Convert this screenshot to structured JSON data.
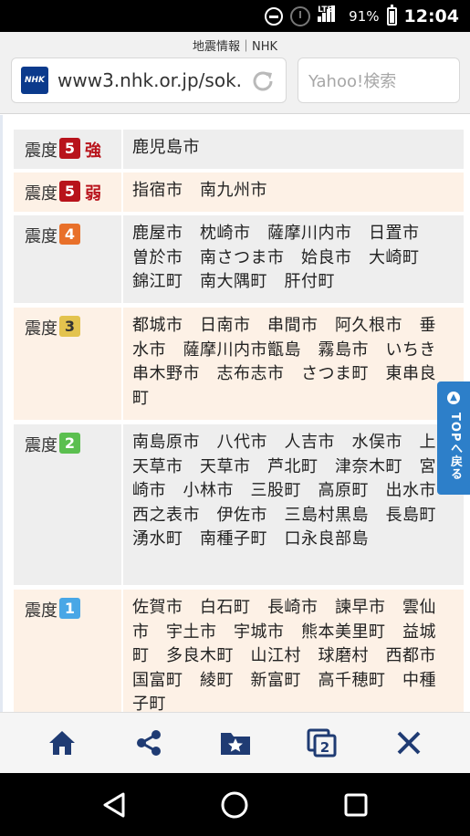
{
  "status": {
    "network": "LTE",
    "battery": "91%",
    "time": "12:04"
  },
  "browser": {
    "site_title": "地震情報｜NHK",
    "logo_text": "NHK",
    "url": "www3.nhk.or.jp/sok...",
    "search_placeholder": "Yahoo!検索"
  },
  "colors": {
    "badge_5": "#b8131b",
    "badge_4": "#e8702a",
    "badge_3": "#e3c34e",
    "badge_2": "#5bbf4f",
    "badge_1": "#49a7e6"
  },
  "rows": [
    {
      "label": "震度",
      "level": "5",
      "suffix": "強",
      "cities": "鹿児島市"
    },
    {
      "label": "震度",
      "level": "5",
      "suffix": "弱",
      "cities": "指宿市　南九州市"
    },
    {
      "label": "震度",
      "level": "4",
      "suffix": "",
      "cities": "鹿屋市　枕崎市　薩摩川内市　日置市　曽於市　南さつま市　姶良市　大崎町　錦江町　南大隅町　肝付町"
    },
    {
      "label": "震度",
      "level": "3",
      "suffix": "",
      "cities": "都城市　日南市　串間市　阿久根市　垂水市　薩摩川内市甑島　霧島市　いちき串木野市　志布志市　さつま町　東串良町"
    },
    {
      "label": "震度",
      "level": "2",
      "suffix": "",
      "cities": "南島原市　八代市　人吉市　水俣市　上天草市　天草市　芦北町　津奈木町　宮崎市　小林市　三股町　高原町　出水市　西之表市　伊佐市　三島村黒島　長島町　湧水町　南種子町　口永良部島"
    },
    {
      "label": "震度",
      "level": "1",
      "suffix": "",
      "cities": "佐賀市　白石町　長崎市　諫早市　雲仙市　宇土市　宇城市　熊本美里町　益城町　多良木町　山江村　球磨村　西都市　国富町　綾町　新富町　高千穂町　中種子町"
    }
  ],
  "top_button": "TOPへ戻る",
  "toolbar": {
    "tabs_count": "2",
    "icons": [
      "home-icon",
      "share-icon",
      "bookmark-icon",
      "tabs-icon",
      "close-icon"
    ]
  },
  "navbar": {
    "icons": [
      "back-icon",
      "home-icon",
      "recents-icon"
    ]
  }
}
